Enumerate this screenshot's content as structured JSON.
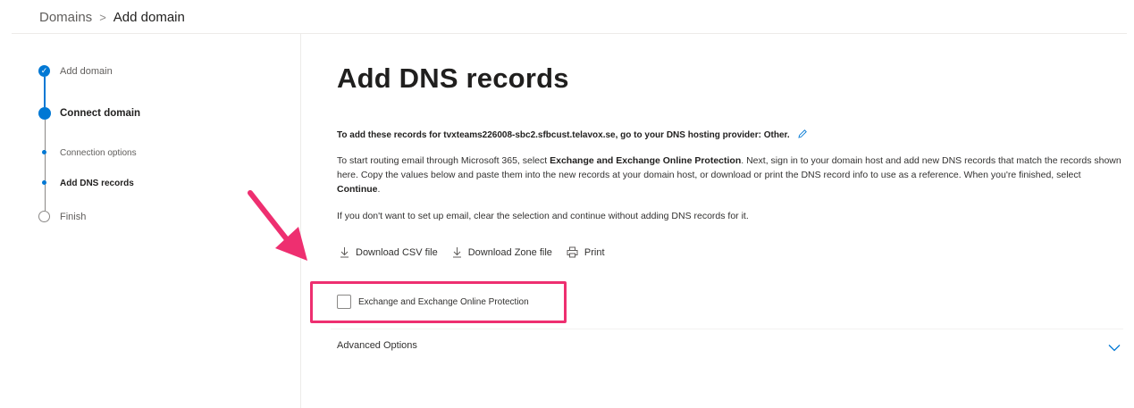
{
  "breadcrumb": {
    "parent": "Domains",
    "separator": ">",
    "current": "Add domain"
  },
  "stepper": {
    "steps": [
      {
        "label": "Add domain",
        "state": "completed"
      },
      {
        "label": "Connect domain",
        "state": "current"
      },
      {
        "label": "Connection options",
        "state": "substep"
      },
      {
        "label": "Add DNS records",
        "state": "substep-current"
      },
      {
        "label": "Finish",
        "state": "pending"
      }
    ],
    "check_glyph": "✓"
  },
  "main": {
    "title": "Add DNS records",
    "intro": "To add these records for tvxteams226008-sbc2.sfbcust.telavox.se, go to your DNS hosting provider: Other.",
    "paragraph": {
      "part1": "To start routing email through Microsoft 365, select ",
      "bold1": "Exchange and Exchange Online Protection",
      "part2": ". Next, sign in to your domain host and add new DNS records that match the records shown here. Copy the values below and paste them into the new records at your domain host, or download or print the DNS record info to use as a reference. When you're finished, select ",
      "bold2": "Continue",
      "part3": "."
    },
    "paragraph2": "If you don't want to set up email, clear the selection and continue without adding DNS records for it.",
    "actions": {
      "download_csv": "Download CSV file",
      "download_zone": "Download Zone file",
      "print": "Print"
    },
    "checkbox_label": "Exchange and Exchange Online Protection",
    "checkbox_checked": false,
    "advanced_options": "Advanced Options"
  },
  "colors": {
    "accent": "#0078d4",
    "highlight": "#ee2f70"
  }
}
